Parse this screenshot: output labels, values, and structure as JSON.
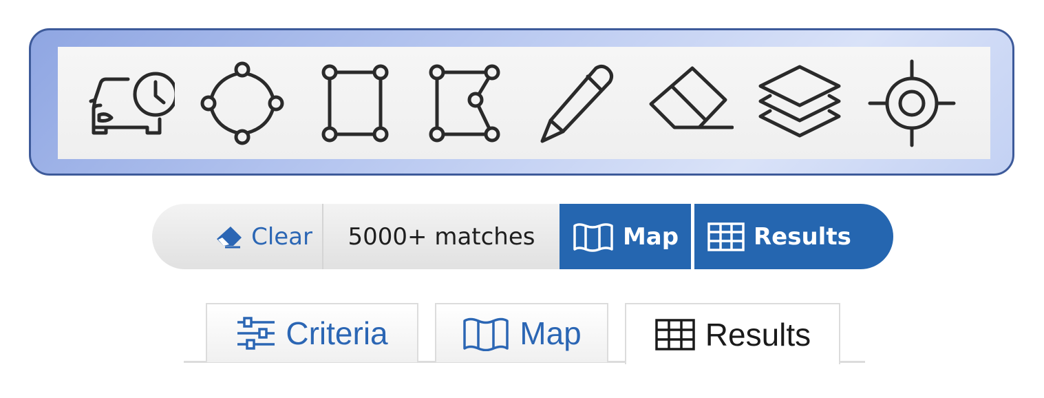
{
  "toolbar": {
    "tools": [
      {
        "icon": "car-clock-icon"
      },
      {
        "icon": "circle-draw-icon"
      },
      {
        "icon": "rectangle-draw-icon"
      },
      {
        "icon": "polygon-draw-icon"
      },
      {
        "icon": "pencil-icon"
      },
      {
        "icon": "eraser-icon"
      },
      {
        "icon": "layers-icon"
      },
      {
        "icon": "locate-crosshair-icon"
      }
    ]
  },
  "status_bar": {
    "clear_label": "Clear",
    "match_count": "5000+ matches",
    "map_label": "Map",
    "results_label": "Results"
  },
  "tabs": [
    {
      "label": "Criteria",
      "icon": "sliders-icon",
      "active": false
    },
    {
      "label": "Map",
      "icon": "map-icon",
      "active": false
    },
    {
      "label": "Results",
      "icon": "table-grid-icon",
      "active": true
    }
  ],
  "colors": {
    "accent_blue": "#2566b0",
    "link_blue": "#2b66b4",
    "panel_border": "#3d5a9a"
  }
}
